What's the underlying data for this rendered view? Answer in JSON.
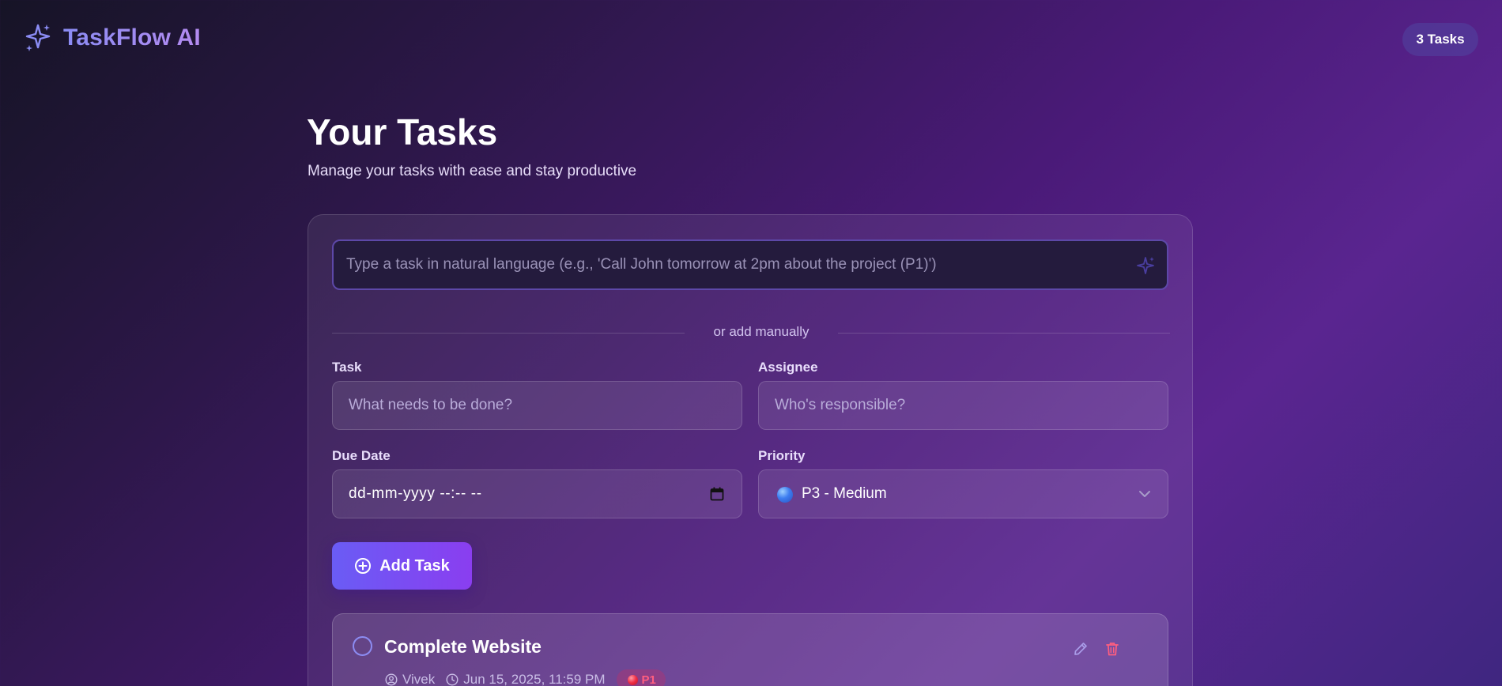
{
  "header": {
    "brand_name": "TaskFlow AI",
    "brand_icon": "sparkles-icon",
    "task_count": "3 Tasks"
  },
  "page": {
    "title": "Your Tasks",
    "subtitle": "Manage your tasks with ease and stay productive"
  },
  "nl_input": {
    "placeholder": "Type a task in natural language (e.g., 'Call John tomorrow at 2pm about the project (P1)')",
    "icon": "sparkles-icon"
  },
  "divider_text": "or add manually",
  "form": {
    "task_label": "Task",
    "task_placeholder": "What needs to be done?",
    "assignee_label": "Assignee",
    "assignee_placeholder": "Who's responsible?",
    "due_date_label": "Due Date",
    "due_date_value": "dd-mm-yyyy --:-- --",
    "priority_label": "Priority",
    "priority_value": "P3 - Medium",
    "priority_color": "#3d7df0",
    "add_button_label": "Add Task"
  },
  "tasks": [
    {
      "title": "Complete Website",
      "assignee": "Vivek",
      "due": "Jun 15, 2025, 11:59 PM",
      "priority": "P1",
      "priority_color": "#ef2c43"
    }
  ],
  "colors": {
    "accent": "#6a5cf5",
    "accent_end": "#8a3ef0",
    "brand_gradient_start": "#8b8cf4",
    "delete": "#ff5e7f"
  }
}
